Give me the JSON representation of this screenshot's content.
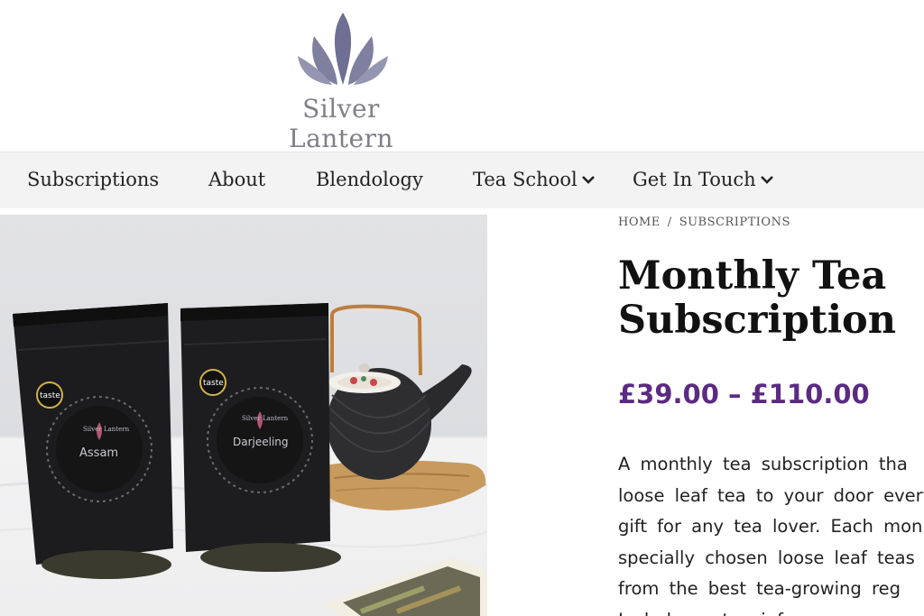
{
  "brand": {
    "name": "Silver Lantern",
    "logo_icon": "lotus-icon",
    "logo_color": "#6e6f92"
  },
  "nav": {
    "items": [
      {
        "label": "Subscriptions",
        "has_dropdown": false
      },
      {
        "label": "About",
        "has_dropdown": false
      },
      {
        "label": "Blendology",
        "has_dropdown": false
      },
      {
        "label": "Tea School",
        "has_dropdown": true
      },
      {
        "label": "Get In Touch",
        "has_dropdown": true
      }
    ]
  },
  "image": {
    "pouches": [
      {
        "brand": "Silver Lantern",
        "name": "Assam",
        "badge": "taste"
      },
      {
        "brand": "Silver Lantern",
        "name": "Darjeeling",
        "badge": "taste"
      }
    ]
  },
  "breadcrumb": {
    "home": "HOME",
    "separator": "/",
    "current": "SUBSCRIPTIONS"
  },
  "product": {
    "title": "Monthly Tea Subscription",
    "price": "£39.00 – £110.00",
    "price_color": "#5b2a82",
    "description_lines": [
      "A monthly tea subscription tha",
      "loose leaf tea to your door every",
      "gift for any tea lover.  Each mon",
      "specially chosen loose leaf teas d",
      "from the best tea-growing reg",
      "Includes a tea infuser."
    ]
  }
}
